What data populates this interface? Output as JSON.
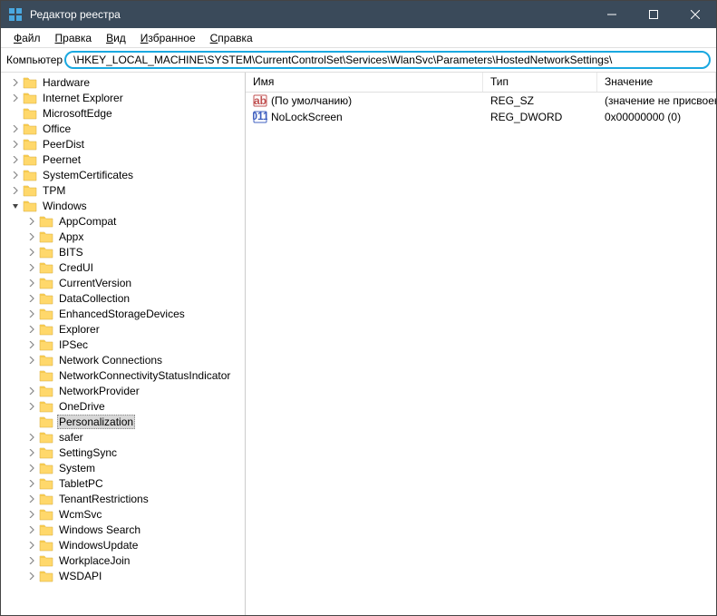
{
  "titlebar": {
    "title": "Редактор реестра"
  },
  "menubar": {
    "items": [
      {
        "label": "Файл",
        "ul": 0
      },
      {
        "label": "Правка",
        "ul": 0
      },
      {
        "label": "Вид",
        "ul": 0
      },
      {
        "label": "Избранное",
        "ul": 0
      },
      {
        "label": "Справка",
        "ul": 0
      }
    ]
  },
  "addressbar": {
    "label": "Компьютер",
    "path": "\\HKEY_LOCAL_MACHINE\\SYSTEM\\CurrentControlSet\\Services\\WlanSvc\\Parameters\\HostedNetworkSettings\\"
  },
  "tree": [
    {
      "indent": 0,
      "expand": "right",
      "label": "Hardware"
    },
    {
      "indent": 0,
      "expand": "right",
      "label": "Internet Explorer"
    },
    {
      "indent": 0,
      "expand": "none",
      "label": "MicrosoftEdge"
    },
    {
      "indent": 0,
      "expand": "right",
      "label": "Office"
    },
    {
      "indent": 0,
      "expand": "right",
      "label": "PeerDist"
    },
    {
      "indent": 0,
      "expand": "right",
      "label": "Peernet"
    },
    {
      "indent": 0,
      "expand": "right",
      "label": "SystemCertificates"
    },
    {
      "indent": 0,
      "expand": "right",
      "label": "TPM"
    },
    {
      "indent": 0,
      "expand": "down",
      "label": "Windows"
    },
    {
      "indent": 1,
      "expand": "right",
      "label": "AppCompat"
    },
    {
      "indent": 1,
      "expand": "right",
      "label": "Appx"
    },
    {
      "indent": 1,
      "expand": "right",
      "label": "BITS"
    },
    {
      "indent": 1,
      "expand": "right",
      "label": "CredUI"
    },
    {
      "indent": 1,
      "expand": "right",
      "label": "CurrentVersion"
    },
    {
      "indent": 1,
      "expand": "right",
      "label": "DataCollection"
    },
    {
      "indent": 1,
      "expand": "right",
      "label": "EnhancedStorageDevices"
    },
    {
      "indent": 1,
      "expand": "right",
      "label": "Explorer"
    },
    {
      "indent": 1,
      "expand": "right",
      "label": "IPSec"
    },
    {
      "indent": 1,
      "expand": "right",
      "label": "Network Connections"
    },
    {
      "indent": 1,
      "expand": "none",
      "label": "NetworkConnectivityStatusIndicator"
    },
    {
      "indent": 1,
      "expand": "right",
      "label": "NetworkProvider"
    },
    {
      "indent": 1,
      "expand": "right",
      "label": "OneDrive"
    },
    {
      "indent": 1,
      "expand": "none",
      "label": "Personalization",
      "selected": true
    },
    {
      "indent": 1,
      "expand": "right",
      "label": "safer"
    },
    {
      "indent": 1,
      "expand": "right",
      "label": "SettingSync"
    },
    {
      "indent": 1,
      "expand": "right",
      "label": "System"
    },
    {
      "indent": 1,
      "expand": "right",
      "label": "TabletPC"
    },
    {
      "indent": 1,
      "expand": "right",
      "label": "TenantRestrictions"
    },
    {
      "indent": 1,
      "expand": "right",
      "label": "WcmSvc"
    },
    {
      "indent": 1,
      "expand": "right",
      "label": "Windows Search"
    },
    {
      "indent": 1,
      "expand": "right",
      "label": "WindowsUpdate"
    },
    {
      "indent": 1,
      "expand": "right",
      "label": "WorkplaceJoin"
    },
    {
      "indent": 1,
      "expand": "right",
      "label": "WSDAPI"
    }
  ],
  "list": {
    "columns": {
      "name": "Имя",
      "type": "Тип",
      "data": "Значение"
    },
    "rows": [
      {
        "icon": "string",
        "name": "(По умолчанию)",
        "type": "REG_SZ",
        "data": "(значение не присвоено)"
      },
      {
        "icon": "binary",
        "name": "NoLockScreen",
        "type": "REG_DWORD",
        "data": "0x00000000 (0)"
      }
    ]
  }
}
